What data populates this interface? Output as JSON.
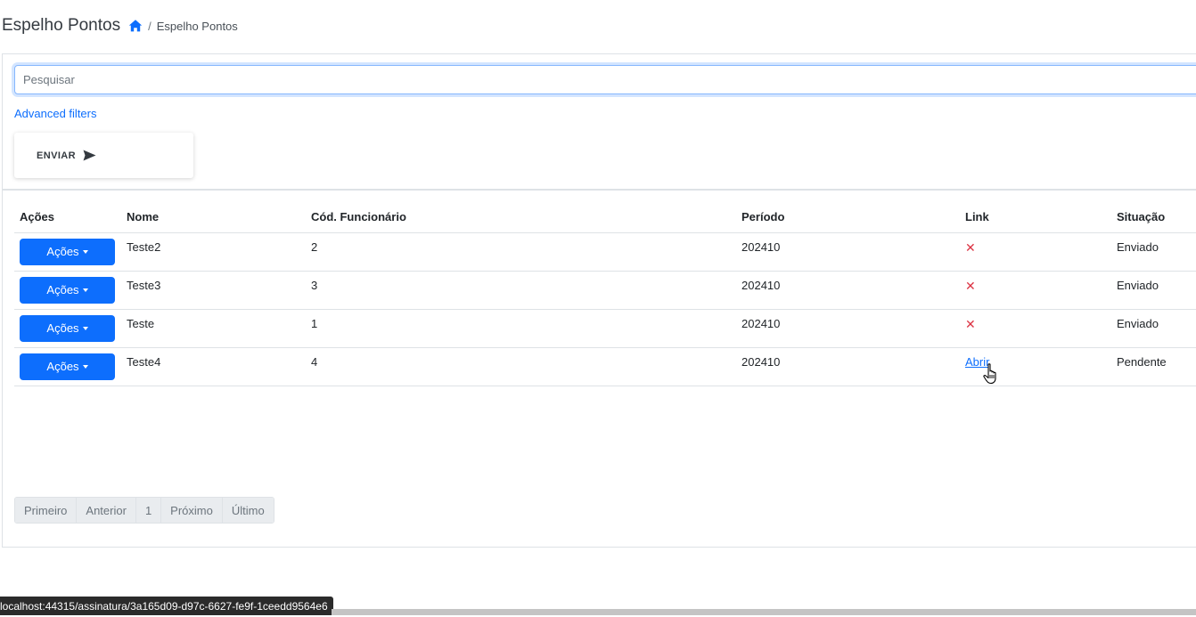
{
  "header": {
    "title": "Espelho Pontos",
    "breadcrumb_current": "Espelho Pontos",
    "breadcrumb_separator": "/"
  },
  "filters": {
    "search_placeholder": "Pesquisar",
    "search_value": "",
    "advanced_filters_label": "Advanced filters",
    "send_label": "ENVIAR"
  },
  "table": {
    "columns": [
      "Ações",
      "Nome",
      "Cód. Funcionário",
      "Período",
      "Link",
      "Situação"
    ],
    "rows": [
      {
        "action_label": "Ações",
        "nome": "Teste2",
        "codigo": "2",
        "periodo": "202410",
        "link": "✕",
        "link_type": "none",
        "situacao": "Enviado"
      },
      {
        "action_label": "Ações",
        "nome": "Teste3",
        "codigo": "3",
        "periodo": "202410",
        "link": "✕",
        "link_type": "none",
        "situacao": "Enviado"
      },
      {
        "action_label": "Ações",
        "nome": "Teste",
        "codigo": "1",
        "periodo": "202410",
        "link": "✕",
        "link_type": "none",
        "situacao": "Enviado"
      },
      {
        "action_label": "Ações",
        "nome": "Teste4",
        "codigo": "4",
        "periodo": "202410",
        "link": "Abrir",
        "link_type": "link",
        "situacao": "Pendente"
      }
    ]
  },
  "pagination": {
    "first": "Primeiro",
    "prev": "Anterior",
    "current": "1",
    "next": "Próximo",
    "last": "Último"
  },
  "status_bar": {
    "url": "localhost:44315/assinatura/3a165d09-d97c-6627-fe9f-1ceedd9564e6"
  },
  "colors": {
    "primary": "#0d6efd",
    "danger": "#dc3545",
    "border": "#dee2e6"
  }
}
